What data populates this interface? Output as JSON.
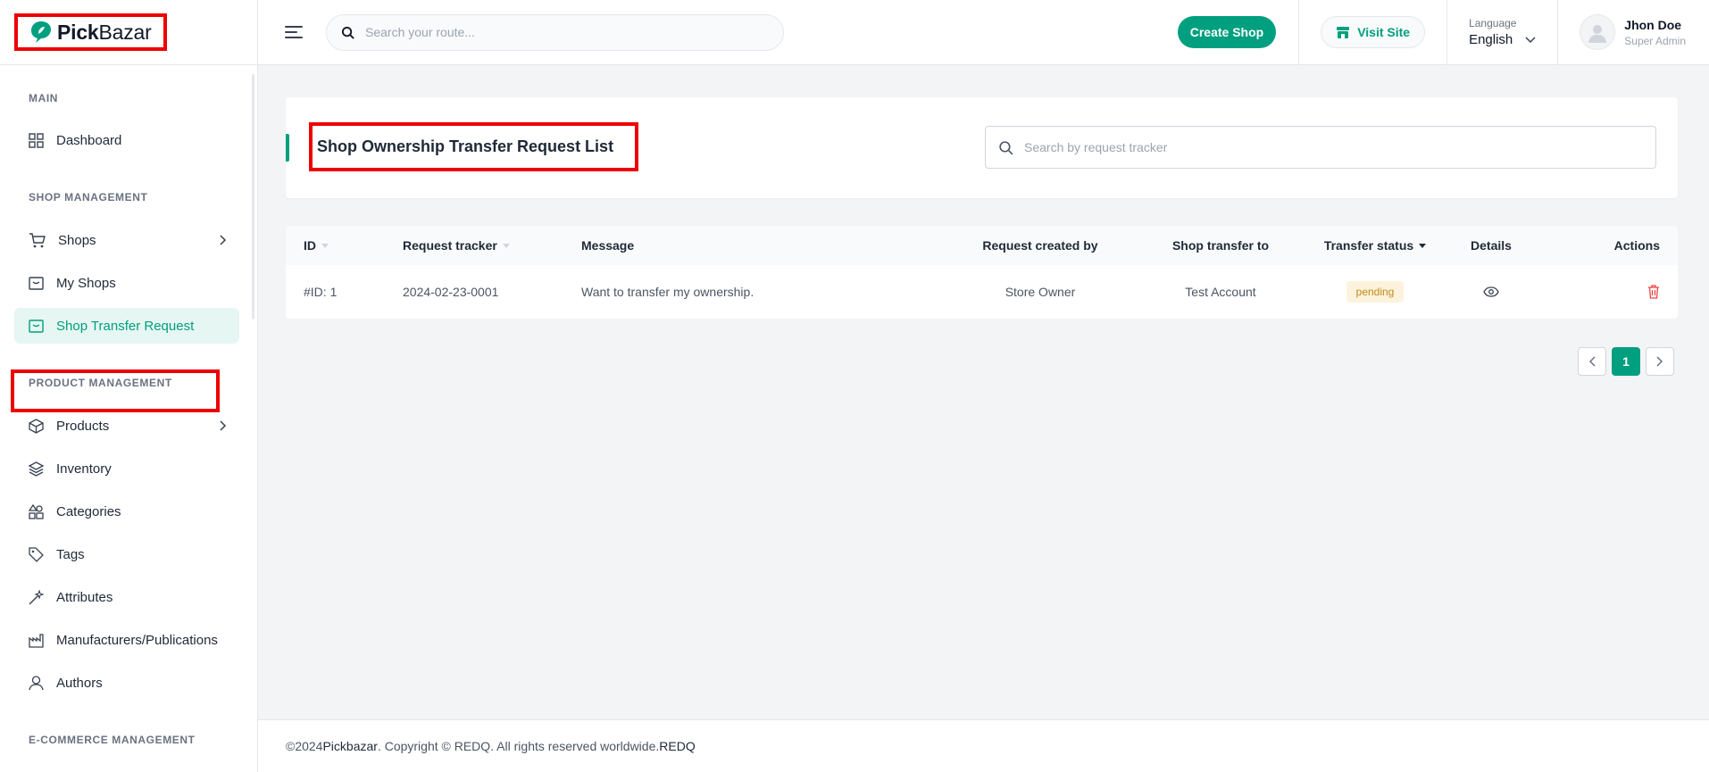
{
  "brand": {
    "name_bold": "Pick",
    "name_light": "Bazar"
  },
  "header": {
    "search_placeholder": "Search your route...",
    "create_shop_label": "Create Shop",
    "visit_site_label": "Visit Site",
    "language_label": "Language",
    "language_value": "English",
    "user_name": "Jhon Doe",
    "user_role": "Super Admin"
  },
  "colors": {
    "accent": "#009f7f",
    "highlight": "#ee0000",
    "badge_bg": "#fdf3dc",
    "badge_text": "#c08a1a",
    "danger": "#ef4444"
  },
  "sidebar": {
    "sections": [
      {
        "title": "MAIN"
      },
      {
        "title": "SHOP MANAGEMENT"
      },
      {
        "title": "PRODUCT MANAGEMENT"
      },
      {
        "title": "E-COMMERCE MANAGEMENT"
      }
    ],
    "items": [
      {
        "label": "Dashboard",
        "icon": "dashboard-grid-icon"
      },
      {
        "label": "Shops",
        "icon": "shopping-cart-icon"
      },
      {
        "label": "My Shops",
        "icon": "storefront-icon"
      },
      {
        "label": "Shop Transfer Request",
        "icon": "storefront-icon",
        "active": true
      },
      {
        "label": "Products",
        "icon": "box-icon"
      },
      {
        "label": "Inventory",
        "icon": "layers-icon"
      },
      {
        "label": "Categories",
        "icon": "shapes-icon"
      },
      {
        "label": "Tags",
        "icon": "tag-icon"
      },
      {
        "label": "Attributes",
        "icon": "magic-wand-icon"
      },
      {
        "label": "Manufacturers/Publications",
        "icon": "factory-icon"
      },
      {
        "label": "Authors",
        "icon": "user-icon"
      }
    ]
  },
  "main": {
    "title": "Shop Ownership Transfer Request List",
    "search_placeholder": "Search by request tracker",
    "table": {
      "columns": [
        "ID",
        "Request tracker",
        "Message",
        "Request created by",
        "Shop transfer to",
        "Transfer status",
        "Details",
        "Actions"
      ],
      "rows": [
        {
          "id": "#ID: 1",
          "tracker": "2024-02-23-0001",
          "message": "Want to transfer my ownership.",
          "created_by": "Store Owner",
          "transfer_to": "Test Account",
          "status": "pending"
        }
      ]
    },
    "pagination": {
      "current": "1"
    }
  },
  "footer": {
    "year": "©2024 ",
    "brand": "Pickbazar",
    "text": ". Copyright © REDQ. All rights reserved worldwide. ",
    "company": "REDQ"
  }
}
